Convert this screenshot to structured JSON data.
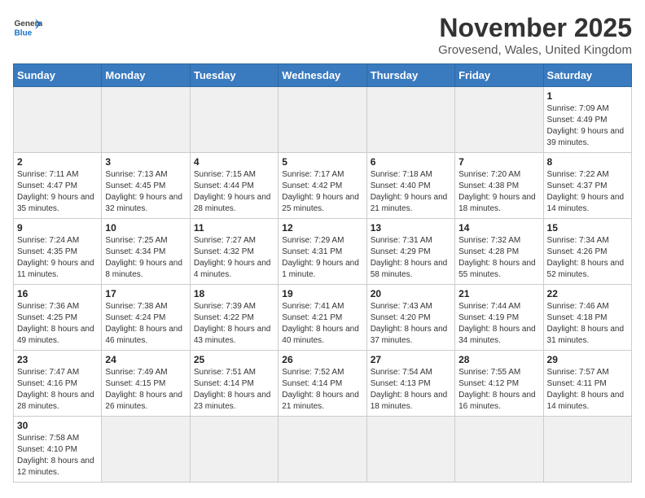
{
  "logo": {
    "text_general": "General",
    "text_blue": "Blue"
  },
  "title": "November 2025",
  "subtitle": "Grovesend, Wales, United Kingdom",
  "weekdays": [
    "Sunday",
    "Monday",
    "Tuesday",
    "Wednesday",
    "Thursday",
    "Friday",
    "Saturday"
  ],
  "weeks": [
    [
      {
        "day": "",
        "empty": true
      },
      {
        "day": "",
        "empty": true
      },
      {
        "day": "",
        "empty": true
      },
      {
        "day": "",
        "empty": true
      },
      {
        "day": "",
        "empty": true
      },
      {
        "day": "",
        "empty": true
      },
      {
        "day": "1",
        "sunrise": "7:09 AM",
        "sunset": "4:49 PM",
        "daylight": "9 hours and 39 minutes."
      }
    ],
    [
      {
        "day": "2",
        "sunrise": "7:11 AM",
        "sunset": "4:47 PM",
        "daylight": "9 hours and 35 minutes."
      },
      {
        "day": "3",
        "sunrise": "7:13 AM",
        "sunset": "4:45 PM",
        "daylight": "9 hours and 32 minutes."
      },
      {
        "day": "4",
        "sunrise": "7:15 AM",
        "sunset": "4:44 PM",
        "daylight": "9 hours and 28 minutes."
      },
      {
        "day": "5",
        "sunrise": "7:17 AM",
        "sunset": "4:42 PM",
        "daylight": "9 hours and 25 minutes."
      },
      {
        "day": "6",
        "sunrise": "7:18 AM",
        "sunset": "4:40 PM",
        "daylight": "9 hours and 21 minutes."
      },
      {
        "day": "7",
        "sunrise": "7:20 AM",
        "sunset": "4:38 PM",
        "daylight": "9 hours and 18 minutes."
      },
      {
        "day": "8",
        "sunrise": "7:22 AM",
        "sunset": "4:37 PM",
        "daylight": "9 hours and 14 minutes."
      }
    ],
    [
      {
        "day": "9",
        "sunrise": "7:24 AM",
        "sunset": "4:35 PM",
        "daylight": "9 hours and 11 minutes."
      },
      {
        "day": "10",
        "sunrise": "7:25 AM",
        "sunset": "4:34 PM",
        "daylight": "9 hours and 8 minutes."
      },
      {
        "day": "11",
        "sunrise": "7:27 AM",
        "sunset": "4:32 PM",
        "daylight": "9 hours and 4 minutes."
      },
      {
        "day": "12",
        "sunrise": "7:29 AM",
        "sunset": "4:31 PM",
        "daylight": "9 hours and 1 minute."
      },
      {
        "day": "13",
        "sunrise": "7:31 AM",
        "sunset": "4:29 PM",
        "daylight": "8 hours and 58 minutes."
      },
      {
        "day": "14",
        "sunrise": "7:32 AM",
        "sunset": "4:28 PM",
        "daylight": "8 hours and 55 minutes."
      },
      {
        "day": "15",
        "sunrise": "7:34 AM",
        "sunset": "4:26 PM",
        "daylight": "8 hours and 52 minutes."
      }
    ],
    [
      {
        "day": "16",
        "sunrise": "7:36 AM",
        "sunset": "4:25 PM",
        "daylight": "8 hours and 49 minutes."
      },
      {
        "day": "17",
        "sunrise": "7:38 AM",
        "sunset": "4:24 PM",
        "daylight": "8 hours and 46 minutes."
      },
      {
        "day": "18",
        "sunrise": "7:39 AM",
        "sunset": "4:22 PM",
        "daylight": "8 hours and 43 minutes."
      },
      {
        "day": "19",
        "sunrise": "7:41 AM",
        "sunset": "4:21 PM",
        "daylight": "8 hours and 40 minutes."
      },
      {
        "day": "20",
        "sunrise": "7:43 AM",
        "sunset": "4:20 PM",
        "daylight": "8 hours and 37 minutes."
      },
      {
        "day": "21",
        "sunrise": "7:44 AM",
        "sunset": "4:19 PM",
        "daylight": "8 hours and 34 minutes."
      },
      {
        "day": "22",
        "sunrise": "7:46 AM",
        "sunset": "4:18 PM",
        "daylight": "8 hours and 31 minutes."
      }
    ],
    [
      {
        "day": "23",
        "sunrise": "7:47 AM",
        "sunset": "4:16 PM",
        "daylight": "8 hours and 28 minutes."
      },
      {
        "day": "24",
        "sunrise": "7:49 AM",
        "sunset": "4:15 PM",
        "daylight": "8 hours and 26 minutes."
      },
      {
        "day": "25",
        "sunrise": "7:51 AM",
        "sunset": "4:14 PM",
        "daylight": "8 hours and 23 minutes."
      },
      {
        "day": "26",
        "sunrise": "7:52 AM",
        "sunset": "4:14 PM",
        "daylight": "8 hours and 21 minutes."
      },
      {
        "day": "27",
        "sunrise": "7:54 AM",
        "sunset": "4:13 PM",
        "daylight": "8 hours and 18 minutes."
      },
      {
        "day": "28",
        "sunrise": "7:55 AM",
        "sunset": "4:12 PM",
        "daylight": "8 hours and 16 minutes."
      },
      {
        "day": "29",
        "sunrise": "7:57 AM",
        "sunset": "4:11 PM",
        "daylight": "8 hours and 14 minutes."
      }
    ],
    [
      {
        "day": "30",
        "sunrise": "7:58 AM",
        "sunset": "4:10 PM",
        "daylight": "8 hours and 12 minutes."
      },
      {
        "day": "",
        "empty": true
      },
      {
        "day": "",
        "empty": true
      },
      {
        "day": "",
        "empty": true
      },
      {
        "day": "",
        "empty": true
      },
      {
        "day": "",
        "empty": true
      },
      {
        "day": "",
        "empty": true
      }
    ]
  ]
}
